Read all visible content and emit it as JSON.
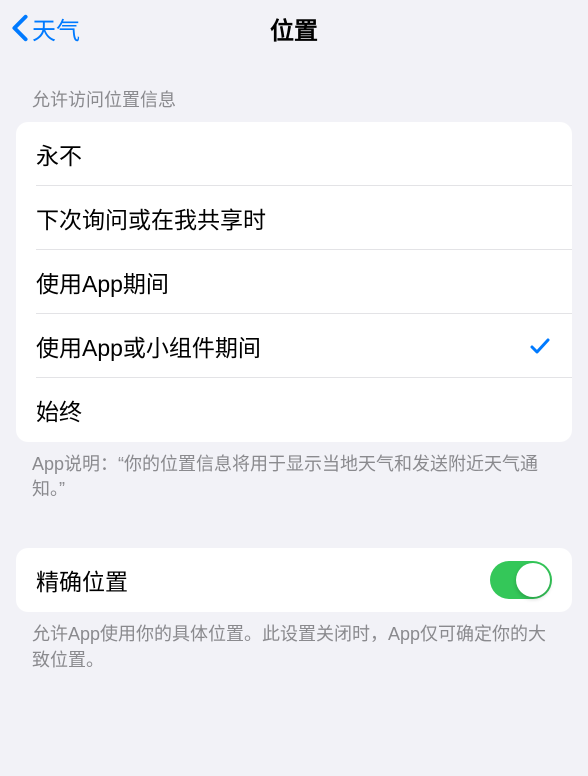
{
  "nav": {
    "back_label": "天气",
    "title": "位置"
  },
  "section1": {
    "header": "允许访问位置信息",
    "footer": "App说明：“你的位置信息将用于显示当地天气和发送附近天气通知。”",
    "options": [
      {
        "label": "永不",
        "selected": false
      },
      {
        "label": "下次询问或在我共享时",
        "selected": false
      },
      {
        "label": "使用App期间",
        "selected": false
      },
      {
        "label": "使用App或小组件期间",
        "selected": true
      },
      {
        "label": "始终",
        "selected": false
      }
    ]
  },
  "section2": {
    "precise_label": "精确位置",
    "precise_on": true,
    "footer": "允许App使用你的具体位置。此设置关闭时，App仅可确定你的大致位置。"
  }
}
